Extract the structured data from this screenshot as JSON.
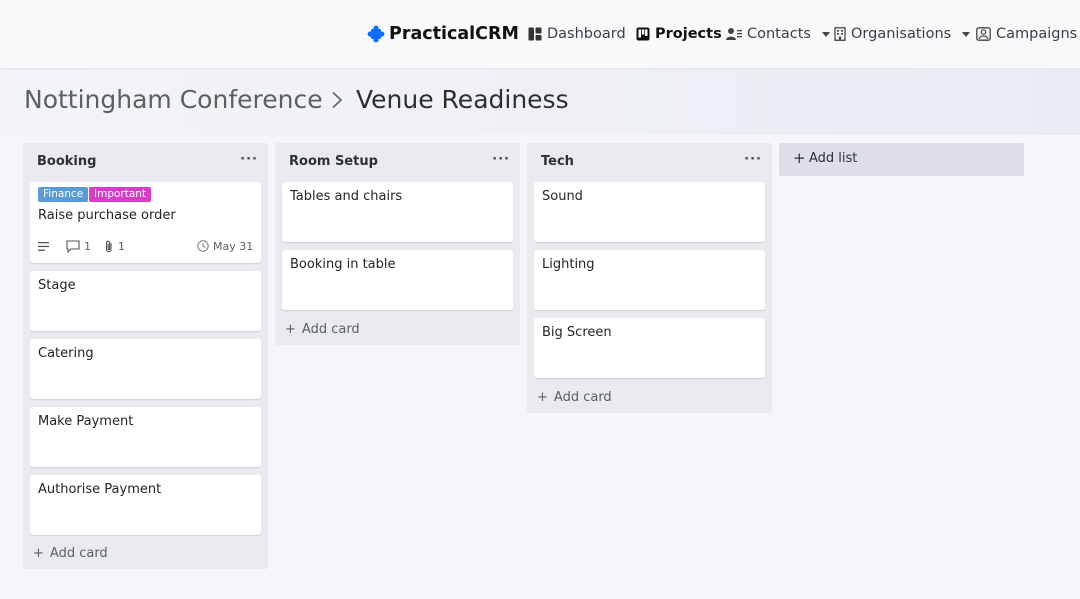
{
  "navbar": {
    "brand": "PracticalCRM",
    "links": {
      "dashboard": "Dashboard",
      "projects": "Projects",
      "contacts": "Contacts",
      "organisations": "Organisations",
      "campaigns": "Campaigns"
    },
    "active": "projects",
    "brand_color": "#0d6efd"
  },
  "breadcrumb": {
    "parent": "Nottingham Conference",
    "separator": "chevron-right-icon",
    "current": "Venue Readiness"
  },
  "board": {
    "lists": [
      {
        "title": "Booking",
        "menu": "···",
        "cards": [
          {
            "title": "Raise purchase order",
            "labels": [
              {
                "text": "Finance",
                "color": "#5b9bd5"
              },
              {
                "text": "Important",
                "color": "#d63cc6"
              }
            ],
            "comments": "1",
            "attachments": "1",
            "due": "May 31",
            "has_description": true
          },
          {
            "title": "Stage"
          },
          {
            "title": "Catering"
          },
          {
            "title": "Make Payment"
          },
          {
            "title": "Authorise Payment"
          }
        ],
        "add_card": "Add card"
      },
      {
        "title": "Room Setup",
        "menu": "···",
        "cards": [
          {
            "title": "Tables and chairs"
          },
          {
            "title": "Booking in table"
          }
        ],
        "add_card": "Add card"
      },
      {
        "title": "Tech",
        "menu": "···",
        "cards": [
          {
            "title": "Sound"
          },
          {
            "title": "Lighting"
          },
          {
            "title": "Big Screen"
          }
        ],
        "add_card": "Add card"
      }
    ],
    "add_list": "Add list",
    "add_symbol": "+"
  }
}
